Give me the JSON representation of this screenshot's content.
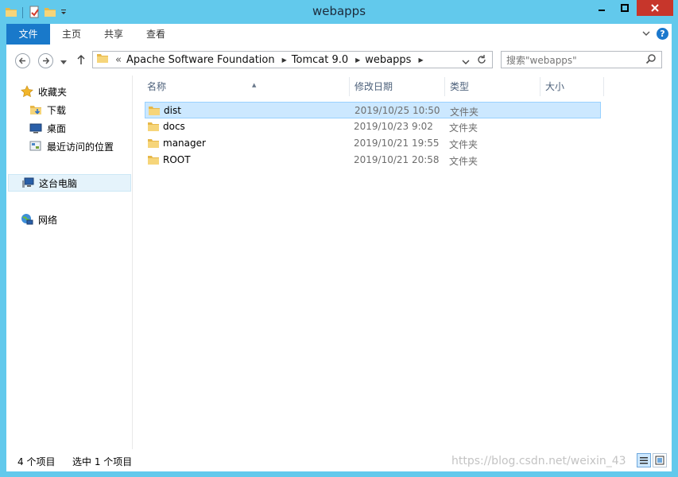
{
  "window": {
    "title": "webapps",
    "buttons": {
      "minimize": "–",
      "maximize": "□",
      "close": "✕"
    }
  },
  "ribbon": {
    "tabs": [
      {
        "label": "文件"
      },
      {
        "label": "主页"
      },
      {
        "label": "共享"
      },
      {
        "label": "查看"
      }
    ]
  },
  "address": {
    "overflow": "«",
    "crumbs": [
      "Apache Software Foundation",
      "Tomcat 9.0",
      "webapps"
    ]
  },
  "search": {
    "placeholder": "搜索\"webapps\""
  },
  "sidebar": {
    "favorites": "收藏夹",
    "downloads": "下载",
    "desktop": "桌面",
    "recent": "最近访问的位置",
    "this_pc": "这台电脑",
    "network": "网络"
  },
  "columns": {
    "name": "名称",
    "modified": "修改日期",
    "type": "类型",
    "size": "大小"
  },
  "files": [
    {
      "name": "dist",
      "modified": "2019/10/25 10:50",
      "type": "文件夹",
      "selected": true
    },
    {
      "name": "docs",
      "modified": "2019/10/23 9:02",
      "type": "文件夹",
      "selected": false
    },
    {
      "name": "manager",
      "modified": "2019/10/21 19:55",
      "type": "文件夹",
      "selected": false
    },
    {
      "name": "ROOT",
      "modified": "2019/10/21 20:58",
      "type": "文件夹",
      "selected": false
    }
  ],
  "status": {
    "count": "4 个项目",
    "selected": "选中 1 个项目",
    "watermark": "https://blog.csdn.net/weixin_43"
  }
}
